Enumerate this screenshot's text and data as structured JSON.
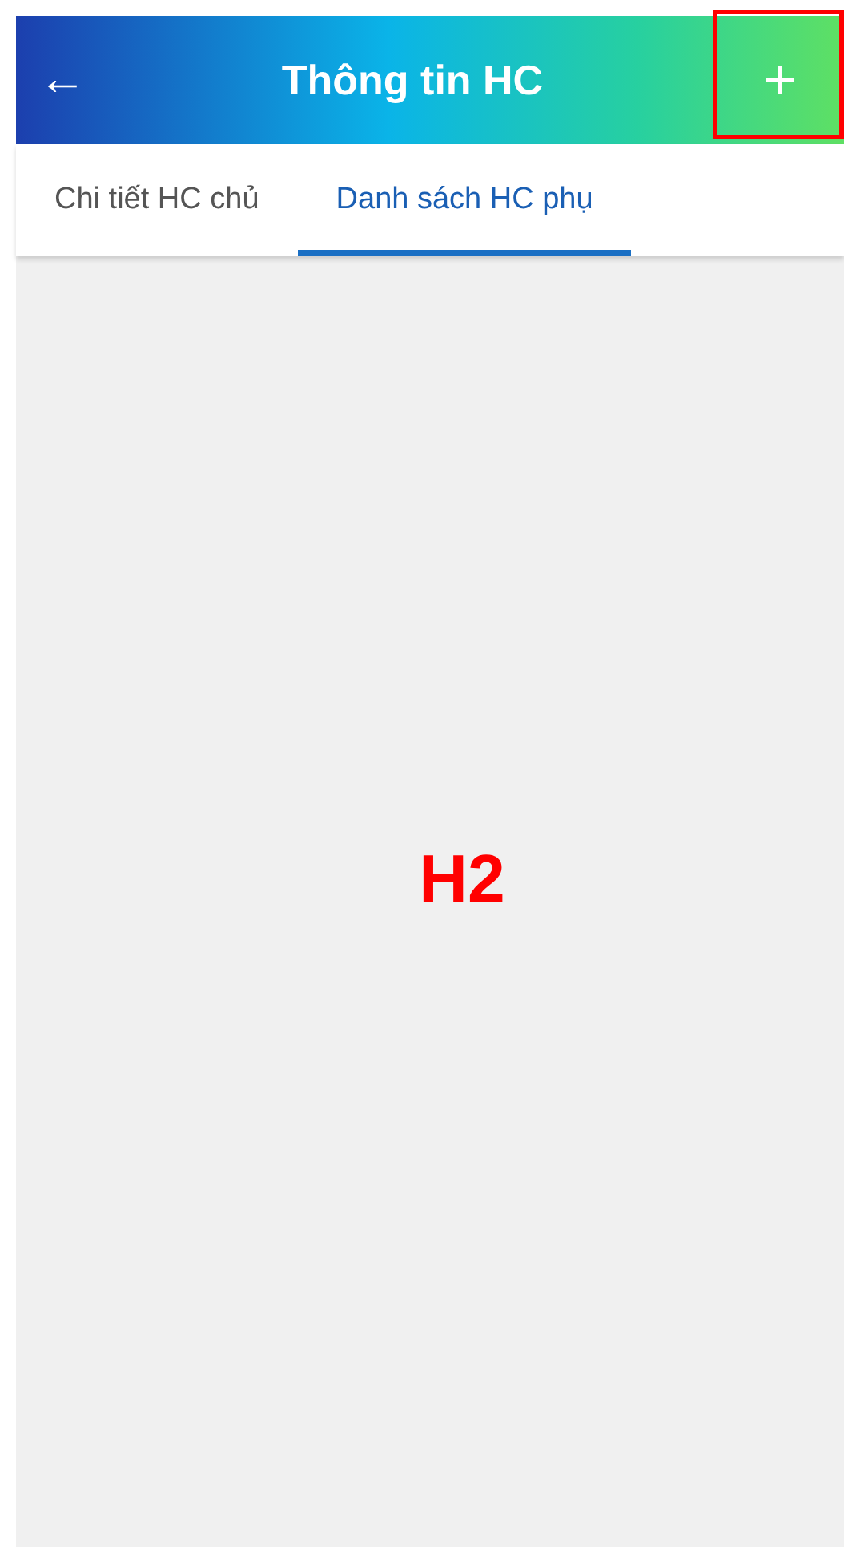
{
  "header": {
    "title": "Thông tin HC",
    "back": "←",
    "add": "+",
    "add_highlighted": true
  },
  "tabs": [
    {
      "label": "Chi tiết HC chủ",
      "selected": false
    },
    {
      "label": "Danh sách HC phụ",
      "selected": true
    }
  ],
  "annotation": "H2"
}
